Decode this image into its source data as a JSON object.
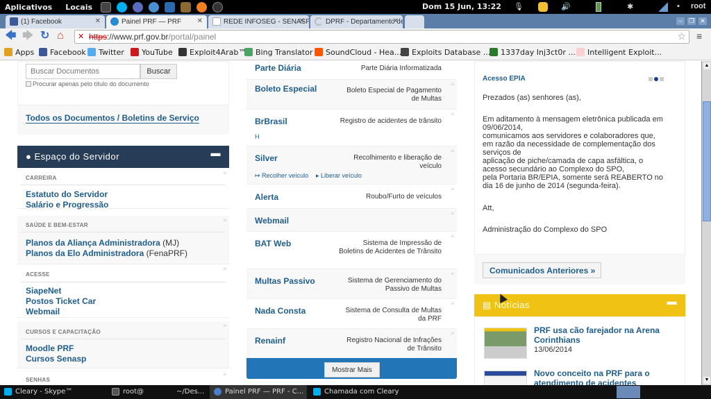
{
  "topbar": {
    "menus": [
      "Aplicativos",
      "Locais"
    ],
    "clock": "Dom 15 Jun, 13:22",
    "user": "root"
  },
  "tabs": [
    {
      "label": "(1) Facebook",
      "active": false
    },
    {
      "label": "Painel PRF — PRF",
      "active": true
    },
    {
      "label": "REDE INFOSEG - SENASP",
      "active": false
    },
    {
      "label": "DPRF - Departamento de",
      "active": false
    }
  ],
  "address": {
    "scheme": "https",
    "host": "://www.prf.gov.br",
    "path": "/portal/painel"
  },
  "bookmarks": [
    {
      "label": "Apps",
      "color": "#e0a020"
    },
    {
      "label": "Facebook",
      "color": "#3b5998"
    },
    {
      "label": "Twitter",
      "color": "#55acee"
    },
    {
      "label": "YouTube",
      "color": "#cc181e"
    },
    {
      "label": "Exploit4Arab™",
      "color": "#333333"
    },
    {
      "label": "Bing Translator",
      "color": "#4aa564"
    },
    {
      "label": "SoundCloud - Hea...",
      "color": "#ff5500"
    },
    {
      "label": "Exploits Database ...",
      "color": "#444444"
    },
    {
      "label": "1337day Inj3ct0r ...",
      "color": "#2a7a2a"
    },
    {
      "label": "Intelligent Exploit...",
      "color": "#e86060"
    }
  ],
  "left": {
    "search_placeholder": "Buscar Documentos",
    "search_button": "Buscar",
    "title_only_label": "Procurar apenas pelo título do documento",
    "all_docs_link": "Todos os Documentos / Boletins de Serviço",
    "panel_title": "Espaço do Servidor",
    "categories": [
      {
        "label": "CARREIRA",
        "links": [
          {
            "text": "Estatuto do Servidor",
            "suffix": ""
          },
          {
            "text": "Salário e Progressão",
            "suffix": ""
          }
        ]
      },
      {
        "label": "SAÚDE E BEM-ESTAR",
        "links": [
          {
            "text": "Planos da Aliança Administradora",
            "suffix": " (MJ)"
          },
          {
            "text": "Planos da Elo Administradora",
            "suffix": " (FenaPRF)"
          }
        ]
      },
      {
        "label": "ACESSE",
        "links": [
          {
            "text": "SiapeNet",
            "suffix": ""
          },
          {
            "text": "Postos Ticket Car",
            "suffix": ""
          },
          {
            "text": "Webmail",
            "suffix": ""
          }
        ]
      },
      {
        "label": "CURSOS E CAPACITAÇÃO",
        "links": [
          {
            "text": "Moodle PRF",
            "suffix": ""
          },
          {
            "text": "Cursos Senasp",
            "suffix": ""
          }
        ]
      },
      {
        "label": "SENHAS",
        "links": []
      }
    ]
  },
  "systems": [
    {
      "name": "Parte Diária",
      "desc": "Parte Diária Informatizada"
    },
    {
      "name": "Boleto Especial",
      "desc": "Boleto Especial de Pagamento de Multas"
    },
    {
      "name": "BrBrasil",
      "desc": "Registro de acidentes de trânsito",
      "extra": "H"
    },
    {
      "name": "Silver",
      "desc": "Recolhimento e liberação de veículo",
      "actions": [
        "Recolher veículo",
        "Liberar veículo"
      ]
    },
    {
      "name": "Alerta",
      "desc": "Roubo/Furto de veículos"
    },
    {
      "name": "Webmail",
      "desc": ""
    },
    {
      "name": "BAT Web",
      "desc": "Sistema de Impressão de Boletins de Acidentes de Trânsito"
    },
    {
      "name": "Multas Passivo",
      "desc": "Sistema de Gerenciamento do Passivo de Multas"
    },
    {
      "name": "Nada Consta",
      "desc": "Sistema de Consulta de Multas da PRF"
    },
    {
      "name": "Renainf",
      "desc": "Registro Nacional de Infrações de Trânsito"
    }
  ],
  "show_more": "Mostrar Mais",
  "notice": {
    "title": "Acesso EPIA",
    "slide_index": 2,
    "slide_count": 3,
    "greeting": "Prezados (as) senhores (as),",
    "body": [
      "Em aditamento à mensagem eletrônica publicada em",
      "09/06/2014,",
      "comunicamos aos servidores e colaboradores que,",
      "em razão da necessidade de complementação dos",
      "serviços de",
      "aplicação de piche/camada de capa asfáltica, o",
      "acesso secundário ao Complexo do SPO,",
      "pela Portaria BR/EPIA, somente será REABERTO no",
      "dia 16 de junho de 2014 (segunda-feira)."
    ],
    "closing": "Att,",
    "signature": "Administração do Complexo do SPO",
    "previous_button": "Comunicados Anteriores »"
  },
  "news": {
    "title": "Notícias",
    "items": [
      {
        "title": "PRF usa cão farejador na Arena Corinthians",
        "date": "13/06/2014"
      },
      {
        "title": "Novo conceito na PRF para o atendimento de acidentes",
        "date": ""
      }
    ]
  },
  "taskbar": [
    {
      "label": "Cleary - Skype™",
      "color": "#00aff0",
      "active": false
    },
    {
      "label": "root@",
      "color": "#555555",
      "active": false
    },
    {
      "label": "~/Des...",
      "color": "",
      "active": false
    },
    {
      "label": "Painel PRF — PRF - C...",
      "color": "#4a7fc8",
      "active": true
    },
    {
      "label": "Chamada com Cleary",
      "color": "#00aff0",
      "active": false
    }
  ],
  "colors": {
    "brand_dark": "#263c57",
    "link": "#1e5d8c",
    "news": "#f0c214",
    "more_bar": "#2275b6"
  }
}
